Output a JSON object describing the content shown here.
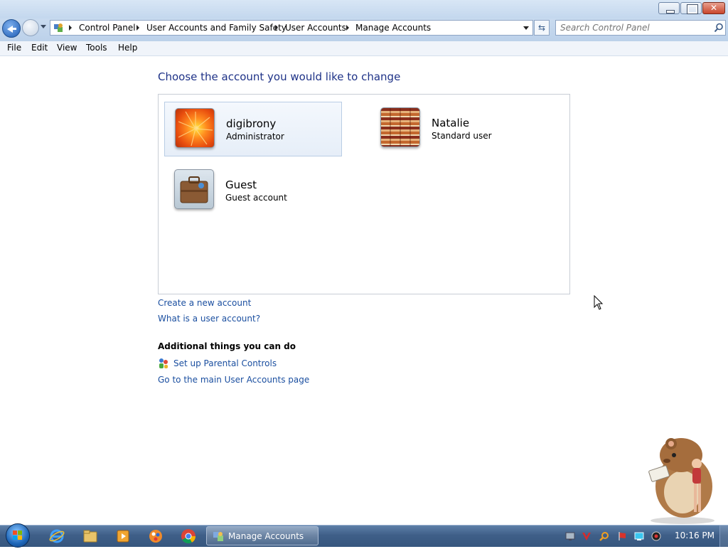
{
  "address_bar": {
    "breadcrumbs": [
      "Control Panel",
      "User Accounts and Family Safety",
      "User Accounts",
      "Manage Accounts"
    ],
    "search_placeholder": "Search Control Panel"
  },
  "menu": [
    "File",
    "Edit",
    "View",
    "Tools",
    "Help"
  ],
  "main": {
    "heading": "Choose the account you would like to change",
    "accounts": [
      {
        "name": "digibrony",
        "role": "Administrator",
        "picture": "orange-flower-picture"
      },
      {
        "name": "Natalie",
        "role": "Standard user",
        "picture": "striped-pattern-picture"
      },
      {
        "name": "Guest",
        "role": "Guest account",
        "picture": "suitcase-picture"
      }
    ],
    "links": {
      "create_account": "Create a new account",
      "what_is_account": "What is a user account?"
    },
    "additional": {
      "heading": "Additional things you can do",
      "parental_controls": "Set up Parental Controls",
      "main_page": "Go to the main User Accounts page"
    }
  },
  "taskbar": {
    "pinned": [
      "internet-explorer-icon",
      "windows-explorer-icon",
      "media-player-icon",
      "paint-app-icon",
      "chrome-icon"
    ],
    "active_task": "Manage Accounts",
    "tray": [
      "network-tray-icon",
      "antivirus-tray-icon",
      "search-tray-icon",
      "flag-tray-icon",
      "display-tray-icon",
      "volume-tray-icon"
    ],
    "clock": "10:16 PM"
  },
  "colors": {
    "heading_blue": "#1e3287",
    "link_blue": "#1b4fa0",
    "taskbar": "#3f5f88"
  }
}
